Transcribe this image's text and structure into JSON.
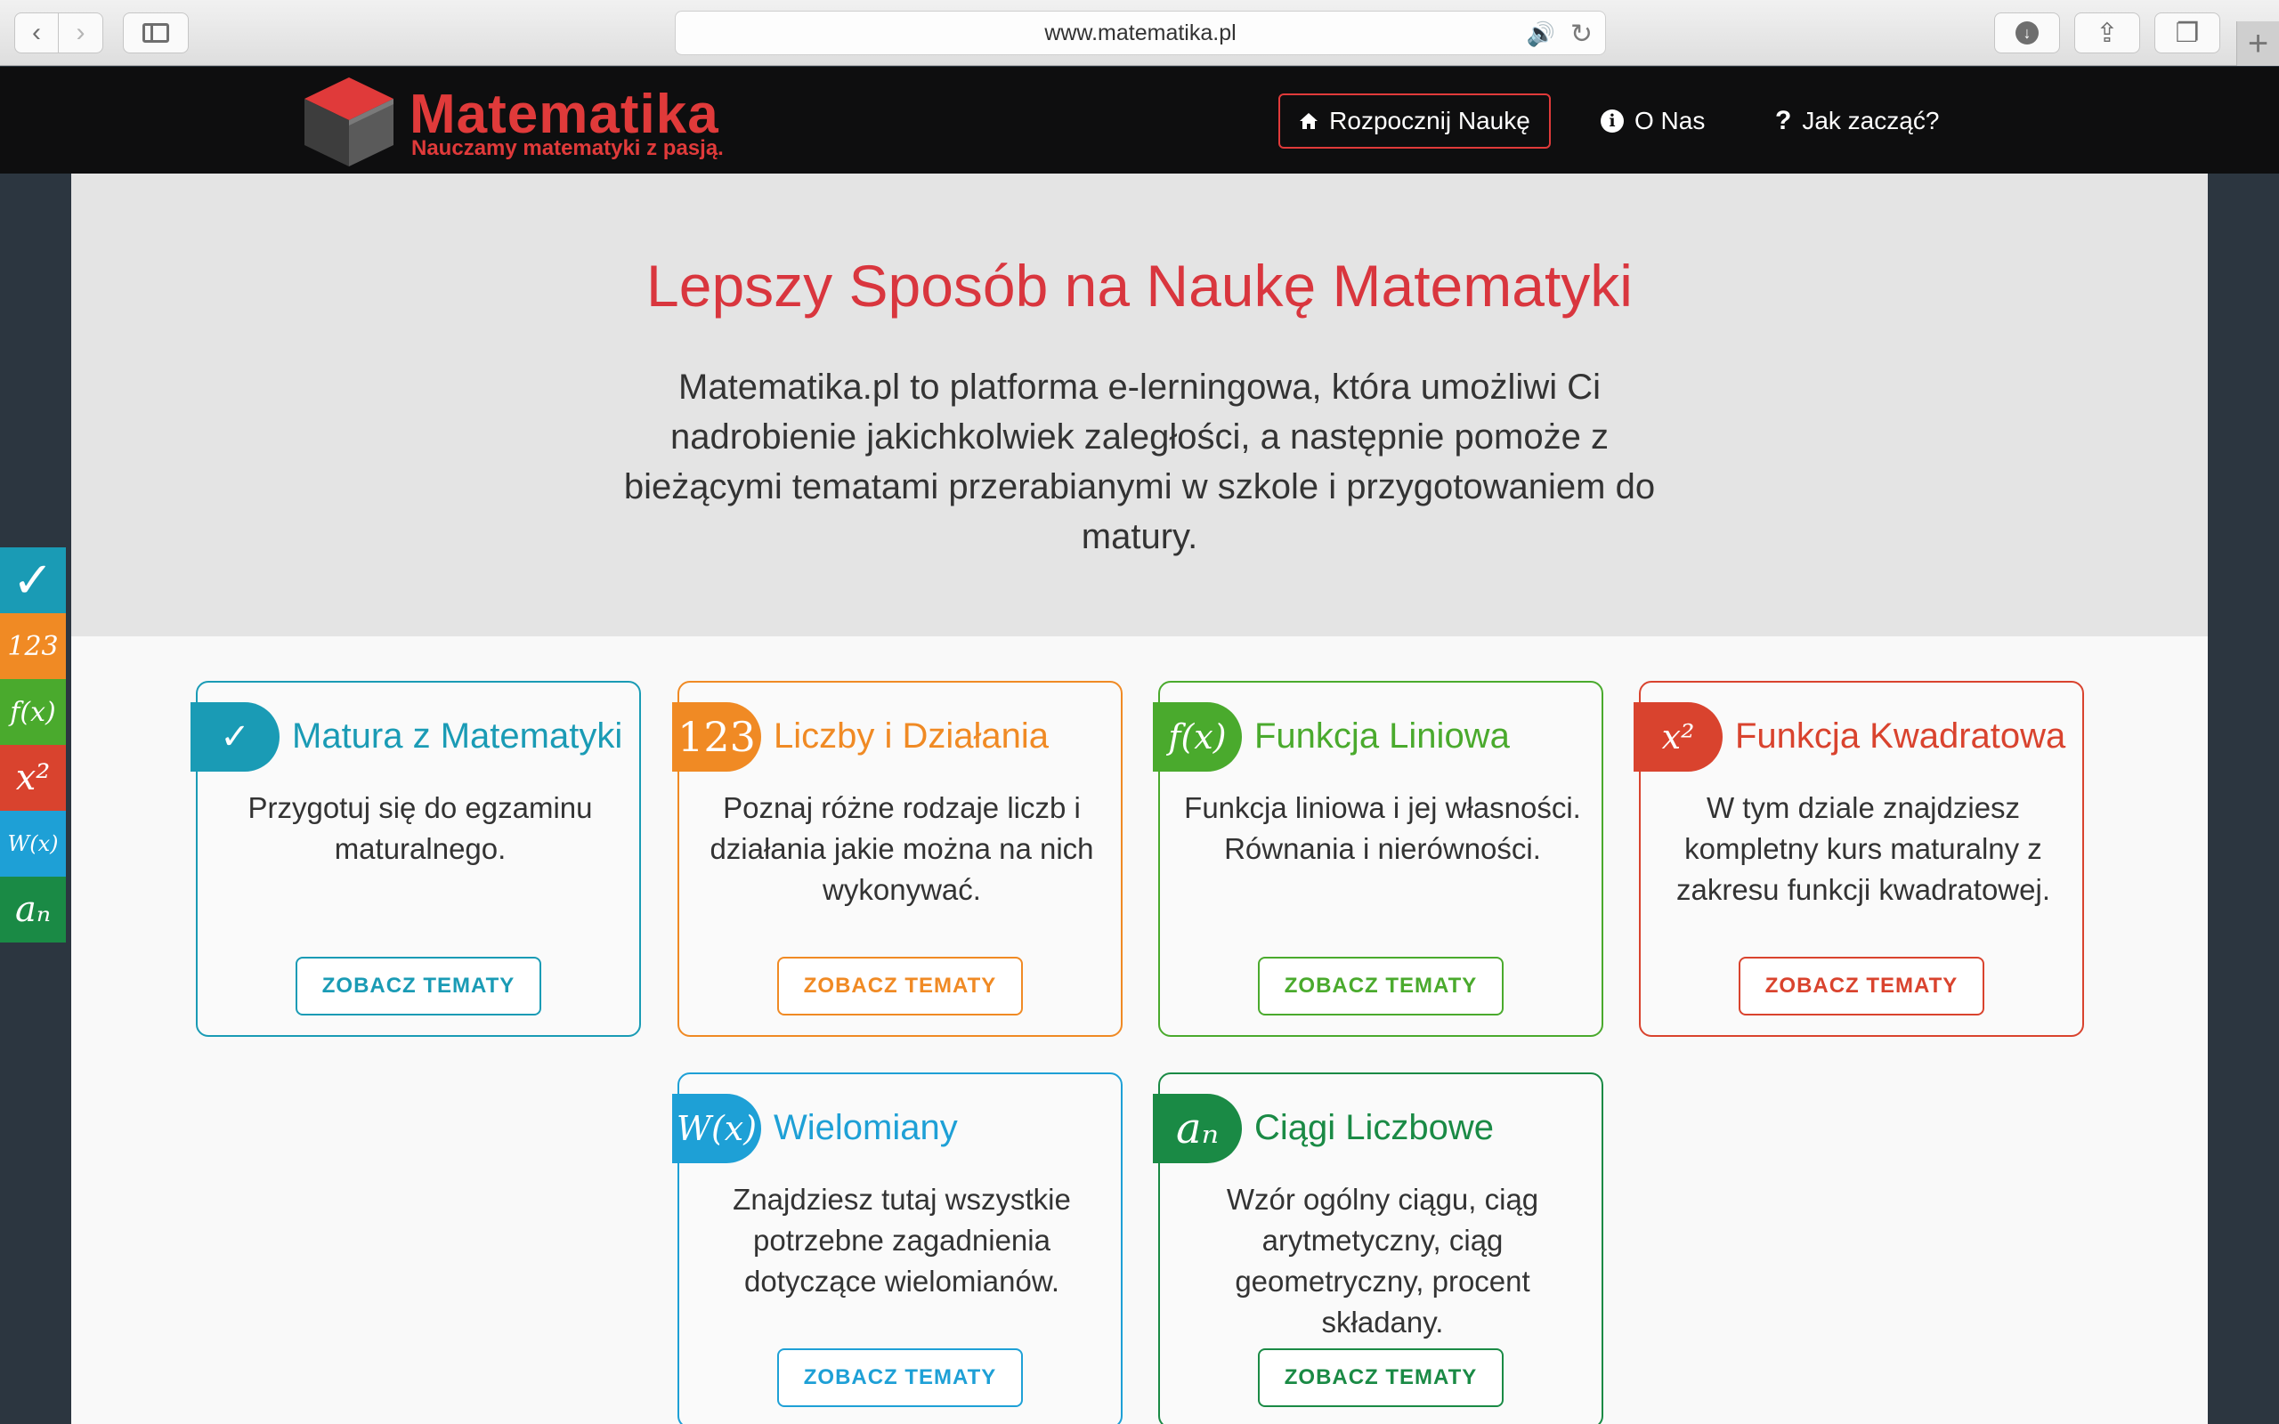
{
  "browser": {
    "url": "www.matematika.pl",
    "back_glyph": "‹",
    "forward_glyph": "›",
    "audio_glyph": "🔊",
    "reload_glyph": "↻",
    "download_glyph": "↓",
    "share_glyph": "⇪",
    "tabs_glyph": "❐",
    "newtab_glyph": "+"
  },
  "site": {
    "logo_title": "Matematika",
    "logo_subtitle": "Nauczamy matematyki z pasją.",
    "nav": [
      {
        "label": "Rozpocznij Naukę",
        "icon": "home-icon",
        "glyph": "⌂"
      },
      {
        "label": "O Nas",
        "icon": "info-icon",
        "glyph": "i"
      },
      {
        "label": "Jak zacząć?",
        "icon": "question-icon",
        "glyph": "?"
      }
    ]
  },
  "hero": {
    "title": "Lepszy Sposób na Naukę Matematyki",
    "description": "Matematika.pl to platforma e-lerningowa, która umożliwi Ci nadrobienie jakichkolwiek zaległości, a następnie pomoże z bieżącymi tematami przerabianymi w szkole i przygotowaniem do matury."
  },
  "cards": [
    {
      "badge": "✓",
      "title": "Matura z Matematyki",
      "desc": "Przygotuj się do egzaminu maturalnego.",
      "button": "ZOBACZ TEMATY",
      "color": "#1a9bb5"
    },
    {
      "badge": "123",
      "title": "Liczby i Działania",
      "desc": "Poznaj różne rodzaje liczb i działania jakie można na nich wykonywać.",
      "button": "ZOBACZ TEMATY",
      "color": "#f08a24"
    },
    {
      "badge": "f(x)",
      "title": "Funkcja Liniowa",
      "desc": "Funkcja liniowa i jej własności. Równania i nierówności.",
      "button": "ZOBACZ TEMATY",
      "color": "#4aaa2d"
    },
    {
      "badge": "x²",
      "title": "Funkcja Kwadratowa",
      "desc": "W tym dziale znajdziesz kompletny kurs maturalny z zakresu funkcji kwadratowej.",
      "button": "ZOBACZ TEMATY",
      "color": "#d9432e"
    },
    {
      "badge": "W(x)",
      "title": "Wielomiany",
      "desc": "Znajdziesz tutaj wszystkie potrzebne zagadnienia dotyczące wielomianów.",
      "button": "ZOBACZ TEMATY",
      "color": "#1ea0d6"
    },
    {
      "badge": "aₙ",
      "title": "Ciągi Liczbowe",
      "desc": "Wzór ogólny ciągu, ciąg arytmetyczny, ciąg geometryczny, procent składany.",
      "button": "ZOBACZ TEMATY",
      "color": "#1a8a45"
    }
  ],
  "side_tabs": [
    {
      "label": "✓",
      "color": "#1a9bb5"
    },
    {
      "label": "123",
      "color": "#f08a24"
    },
    {
      "label": "f(x)",
      "color": "#4aaa2d"
    },
    {
      "label": "x²",
      "color": "#d9432e"
    },
    {
      "label": "W(x)",
      "color": "#1ea0d6"
    },
    {
      "label": "aₙ",
      "color": "#1a8a45"
    }
  ]
}
